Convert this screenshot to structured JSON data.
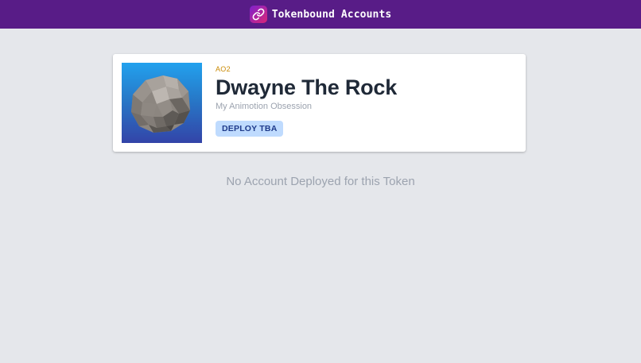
{
  "header": {
    "logo_icon": "link-icon",
    "title": "Tokenbound Accounts"
  },
  "token_card": {
    "image_icon": "rock-image",
    "collection": "AO2",
    "name": "Dwayne The Rock",
    "subtitle": "My Animotion Obsession",
    "deploy_label": "DEPLOY TBA"
  },
  "main": {
    "empty_message": "No Account Deployed for this Token"
  },
  "colors": {
    "header_bg": "#581c87",
    "page_bg": "#e5e7eb",
    "collection_text": "#ca8a04",
    "button_bg": "#bfdbfe",
    "button_text": "#1e3a8a"
  }
}
